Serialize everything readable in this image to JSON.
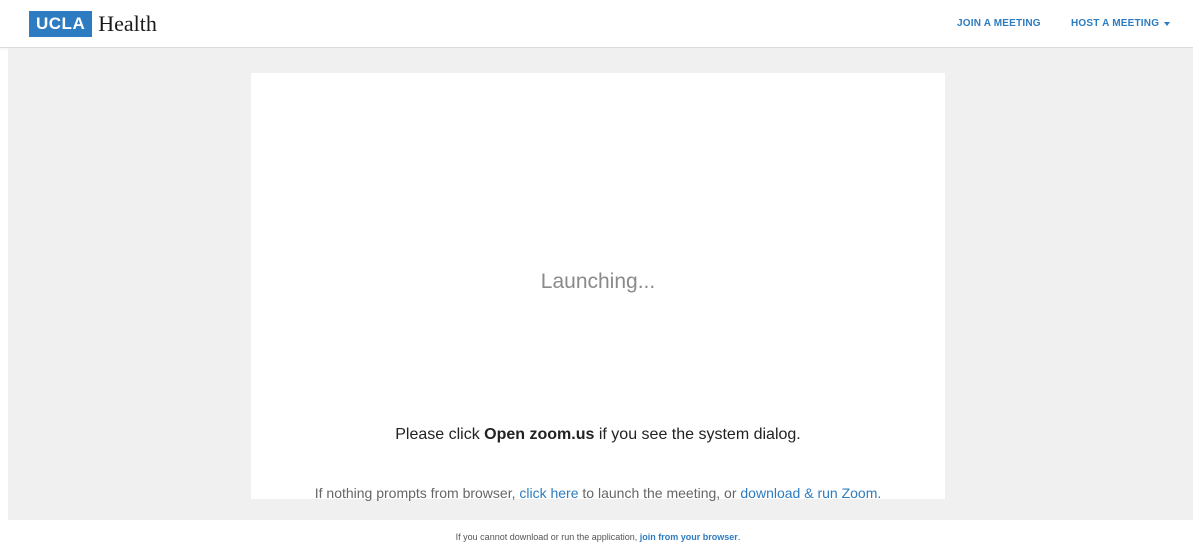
{
  "header": {
    "logo_badge": "UCLA",
    "logo_word": "Health",
    "nav_join": "JOIN A MEETING",
    "nav_host": "HOST A MEETING"
  },
  "main": {
    "status": "Launching...",
    "instruction_prefix": "Please click ",
    "instruction_bold": "Open zoom.us",
    "instruction_suffix": " if you see the system dialog.",
    "fallback_prefix": "If nothing prompts from browser, ",
    "fallback_link1": "click here",
    "fallback_middle": " to launch the meeting, or ",
    "fallback_link2": "download & run Zoom",
    "fallback_suffix": ".",
    "browser_prefix": "If you cannot download or run the application, ",
    "browser_link": "join from your browser",
    "browser_suffix": "."
  },
  "colors": {
    "brand": "#2d7cc1",
    "background": "#f0f0f0"
  },
  "icons": {
    "host_dropdown": "caret-down-icon"
  }
}
